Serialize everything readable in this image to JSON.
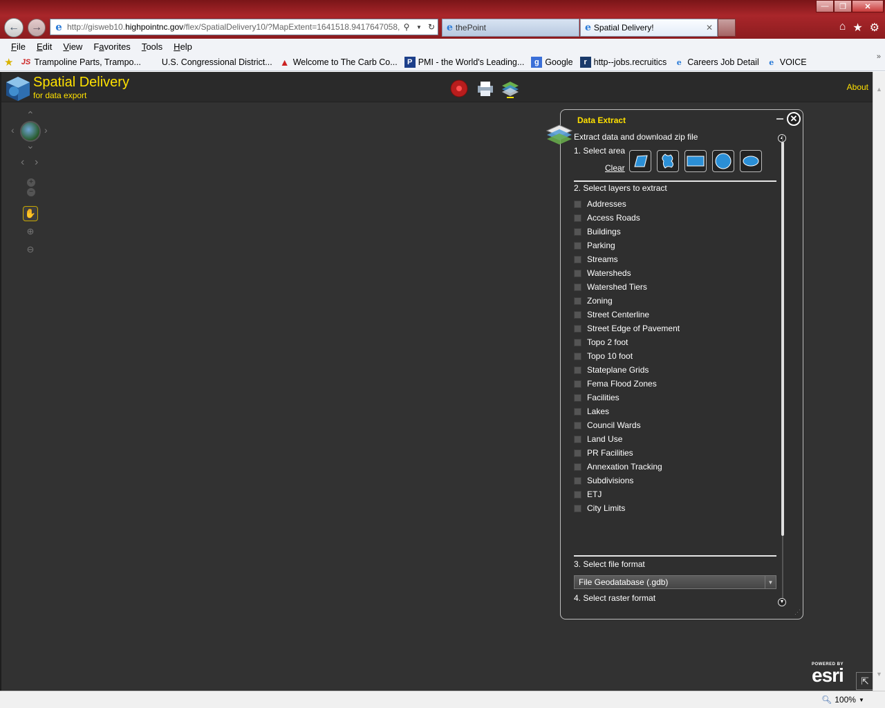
{
  "browser": {
    "address_url": "http://gisweb10.highpointnc.gov/flex/SpatialDelivery10/?MapExtent=1641518.9417647058,7",
    "address_host_prefix": "http://gisweb10.",
    "address_host_domain": "highpointnc.gov",
    "address_path": "/flex/SpatialDelivery10/?MapExtent=1641518.9417647058,7",
    "tabs": [
      {
        "label": "thePoint"
      },
      {
        "label": "Spatial Delivery!"
      }
    ],
    "window_controls": {
      "minimize": "—",
      "restore": "❐",
      "close": "✕"
    }
  },
  "menu": {
    "items": [
      {
        "letter": "F",
        "rest": "ile"
      },
      {
        "letter": "E",
        "rest": "dit"
      },
      {
        "letter": "V",
        "rest": "iew"
      },
      {
        "letter": "F",
        "rest": "avorites",
        "label_prefix": "",
        "alt": "a"
      },
      {
        "letter": "T",
        "rest": "ools"
      },
      {
        "letter": "H",
        "rest": "elp"
      }
    ]
  },
  "favorites": [
    {
      "label": "Trampoline Parts, Trampo...",
      "icon": "js-icon"
    },
    {
      "label": "U.S. Congressional District...",
      "icon": "blank-icon"
    },
    {
      "label": "Welcome to The Carb Co...",
      "icon": "carb-icon"
    },
    {
      "label": "PMI - the World's Leading...",
      "icon": "pmi-icon"
    },
    {
      "label": "Google",
      "icon": "google-icon"
    },
    {
      "label": "http--jobs.recruitics",
      "icon": "recruitics-icon"
    },
    {
      "label": "Careers  Job Detail",
      "icon": "ie-page-icon"
    },
    {
      "label": "VOICE",
      "icon": "ie-page-icon"
    }
  ],
  "app": {
    "title": "Spatial Delivery",
    "subtitle": "for data export",
    "about": "About",
    "accent": "#ffe100"
  },
  "panel": {
    "title": "Data Extract",
    "intro": "Extract data and download zip file",
    "step1": "1. Select area",
    "clear": "Clear",
    "step2": "2. Select layers to extract",
    "layers": [
      "Addresses",
      "Access Roads",
      "Buildings",
      "Parking",
      "Streams",
      "Watersheds",
      "Watershed Tiers",
      "Zoning",
      "Street Centerline",
      "Street Edge of Pavement",
      "Topo 2 foot",
      "Topo 10 foot",
      "Stateplane Grids",
      "Fema Flood Zones",
      "Facilities",
      "Lakes",
      "Council Wards",
      "Land Use",
      "PR Facilities",
      "Annexation Tracking",
      "Subdivisions",
      "ETJ",
      "City Limits"
    ],
    "step3": "3. Select file format",
    "file_format": "File Geodatabase (.gdb)",
    "step4": "4. Select raster format"
  },
  "esri": {
    "powered": "POWERED BY",
    "name": "esri"
  },
  "status": {
    "zoom": "100%"
  }
}
